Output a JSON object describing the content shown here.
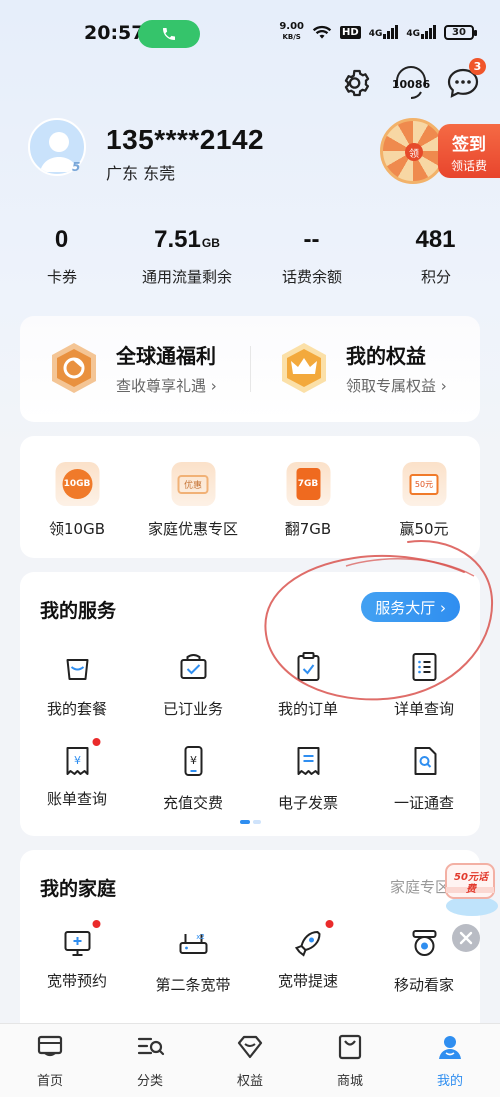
{
  "status_bar": {
    "time": "20:57",
    "net_speed_value": "9.00",
    "net_speed_unit": "KB/S",
    "hd": "HD",
    "sim1": "4G",
    "sim2": "4G",
    "battery": "30"
  },
  "header": {
    "hotline_label": "10086",
    "messages_badge": "3"
  },
  "profile": {
    "phone": "135****2142",
    "location": "广东 东莞",
    "level": "5",
    "signin_title": "签到",
    "signin_subtitle": "领话费"
  },
  "stats": [
    {
      "value": "0",
      "unit": "",
      "label": "卡券"
    },
    {
      "value": "7.51",
      "unit": "GB",
      "label": "通用流量剩余"
    },
    {
      "value": "--",
      "unit": "",
      "label": "话费余额"
    },
    {
      "value": "481",
      "unit": "",
      "label": "积分"
    }
  ],
  "benefits": [
    {
      "title": "全球通福利",
      "subtitle": "查收尊享礼遇 ›"
    },
    {
      "title": "我的权益",
      "subtitle": "领取专属权益 ›"
    }
  ],
  "promos": [
    {
      "label": "领10GB",
      "icon_text": "10GB"
    },
    {
      "label": "家庭优惠专区",
      "icon_text": "优惠"
    },
    {
      "label": "翻7GB",
      "icon_text": "7GB"
    },
    {
      "label": "赢50元",
      "icon_text": "50元"
    }
  ],
  "services": {
    "title": "我的服务",
    "hall_button": "服务大厅 ›",
    "items": [
      {
        "label": "我的套餐",
        "icon": "bag-icon"
      },
      {
        "label": "已订业务",
        "icon": "subscribed-icon"
      },
      {
        "label": "我的订单",
        "icon": "order-clipboard-icon"
      },
      {
        "label": "详单查询",
        "icon": "detail-list-icon"
      },
      {
        "label": "账单查询",
        "icon": "bill-icon"
      },
      {
        "label": "充值交费",
        "icon": "recharge-phone-icon"
      },
      {
        "label": "电子发票",
        "icon": "invoice-icon"
      },
      {
        "label": "一证通查",
        "icon": "id-search-icon"
      }
    ]
  },
  "family": {
    "title": "我的家庭",
    "more_link": "家庭专区",
    "float_ad_text": "50元话费",
    "items": [
      {
        "label": "宽带预约",
        "icon": "broadband-tv-icon"
      },
      {
        "label": "第二条宽带",
        "icon": "router-icon"
      },
      {
        "label": "宽带提速",
        "icon": "rocket-icon"
      },
      {
        "label": "移动看家",
        "icon": "camera-icon"
      }
    ]
  },
  "bottom_nav": [
    {
      "label": "首页",
      "icon": "home-icon"
    },
    {
      "label": "分类",
      "icon": "category-icon"
    },
    {
      "label": "权益",
      "icon": "diamond-icon"
    },
    {
      "label": "商城",
      "icon": "shop-icon"
    },
    {
      "label": "我的",
      "icon": "profile-icon"
    }
  ],
  "colors": {
    "accent": "#2f8ef0",
    "badge": "#f0552a",
    "red_dot": "#ea2b2b",
    "gold": "#f0a24a",
    "annotation": "#d9534f"
  }
}
